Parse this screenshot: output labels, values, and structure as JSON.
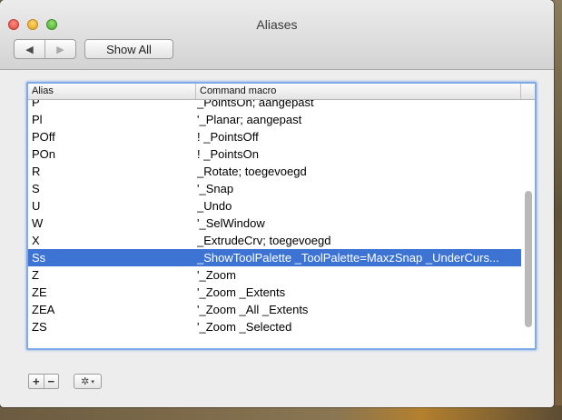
{
  "window": {
    "title": "Aliases"
  },
  "toolbar": {
    "back_icon": "left-triangle-icon",
    "forward_icon": "right-triangle-icon",
    "show_all_label": "Show All"
  },
  "table": {
    "columns": {
      "alias": "Alias",
      "macro": "Command macro"
    },
    "rows": [
      {
        "alias": "P",
        "macro": "_PointsOn; aangepast"
      },
      {
        "alias": "Pl",
        "macro": "'_Planar; aangepast"
      },
      {
        "alias": "POff",
        "macro": "! _PointsOff"
      },
      {
        "alias": "POn",
        "macro": "! _PointsOn"
      },
      {
        "alias": "R",
        "macro": "_Rotate; toegevoegd"
      },
      {
        "alias": "S",
        "macro": "'_Snap"
      },
      {
        "alias": "U",
        "macro": "_Undo"
      },
      {
        "alias": "W",
        "macro": "'_SelWindow"
      },
      {
        "alias": "X",
        "macro": "_ExtrudeCrv; toegevoegd"
      },
      {
        "alias": "Ss",
        "macro": "_ShowToolPalette _ToolPalette=MaxzSnap _UnderCurs...",
        "selected": true
      },
      {
        "alias": "Z",
        "macro": "'_Zoom"
      },
      {
        "alias": "ZE",
        "macro": "'_Zoom _Extents"
      },
      {
        "alias": "ZEA",
        "macro": "'_Zoom _All _Extents"
      },
      {
        "alias": "ZS",
        "macro": "'_Zoom _Selected"
      }
    ],
    "selected_color": "#3d74d4"
  },
  "footer": {
    "add_label": "+",
    "remove_label": "−",
    "gear_icon": "gear-icon",
    "gear_caret": "▾"
  }
}
